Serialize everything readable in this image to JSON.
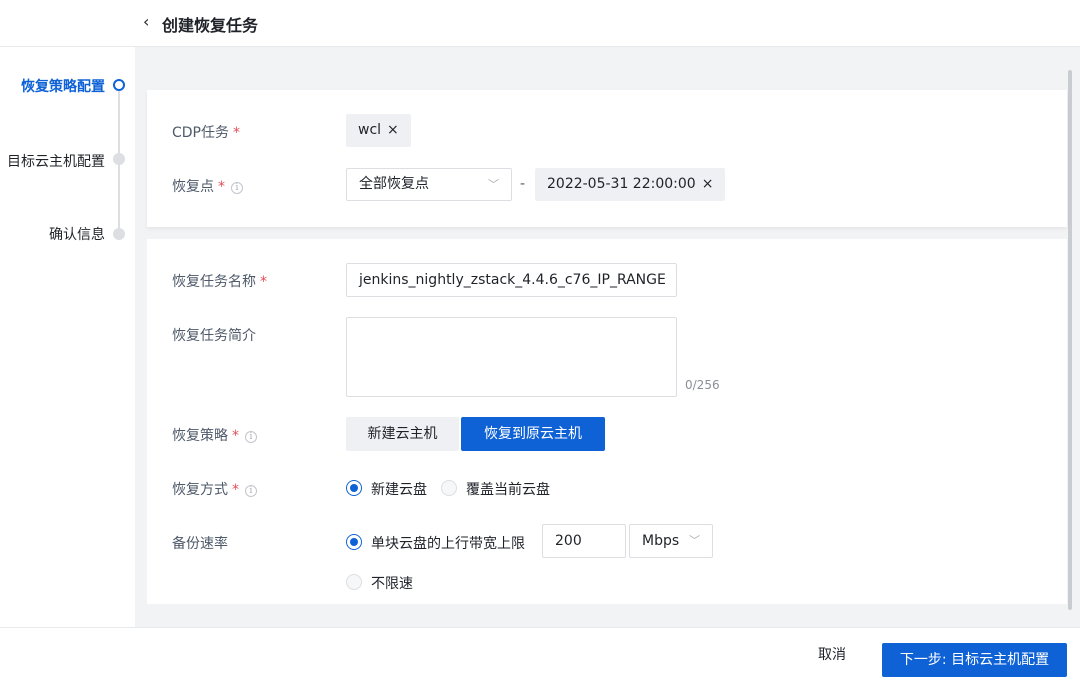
{
  "header": {
    "back_icon": "chevron-left-icon",
    "back_glyph": "‹",
    "title": "创建恢复任务"
  },
  "stepper": {
    "steps": [
      {
        "label": "恢复策略配置",
        "state": "active"
      },
      {
        "label": "目标云主机配置",
        "state": "pending"
      },
      {
        "label": "确认信息",
        "state": "pending"
      }
    ]
  },
  "form": {
    "cdp_task": {
      "label": "CDP任务",
      "required_mark": "*",
      "tag": "wcl",
      "remove": "×"
    },
    "recovery_point": {
      "label": "恢复点",
      "required_mark": "*",
      "info": "i",
      "select_value": "全部恢复点",
      "separator": "-",
      "time_tag": "2022-05-31 22:00:00",
      "remove": "×"
    },
    "task_name": {
      "label": "恢复任务名称",
      "required_mark": "*",
      "value": "jenkins_nightly_zstack_4.4.6_c76_IP_RANGE"
    },
    "task_desc": {
      "label": "恢复任务简介",
      "value": "",
      "counter": "0/256"
    },
    "strategy": {
      "label": "恢复策略",
      "required_mark": "*",
      "info": "i",
      "options": [
        "新建云主机",
        "恢复到原云主机"
      ],
      "selected": "恢复到原云主机"
    },
    "method": {
      "label": "恢复方式",
      "required_mark": "*",
      "info": "i",
      "options": [
        "新建云盘",
        "覆盖当前云盘"
      ],
      "selected": "新建云盘"
    },
    "rate": {
      "label": "备份速率",
      "limit_label": "单块云盘的上行带宽上限",
      "limit_value": "200",
      "unit": "Mbps",
      "unlimited_label": "不限速",
      "selected": "单块云盘的上行带宽上限"
    }
  },
  "footer": {
    "cancel": "取消",
    "next": "下一步: 目标云主机配置"
  },
  "colors": {
    "primary": "#0f62d6",
    "required": "#e34d59",
    "background": "#f2f3f5"
  }
}
